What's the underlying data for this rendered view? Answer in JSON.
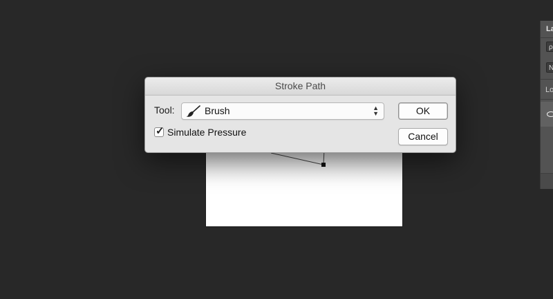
{
  "dialog": {
    "title": "Stroke Path",
    "tool_label": "Tool:",
    "tool_value": "Brush",
    "tool_icon": "brush-icon",
    "simulate_pressure_label": "Simulate Pressure",
    "simulate_pressure_checked": true,
    "ok_label": "OK",
    "cancel_label": "Cancel"
  },
  "layers_panel": {
    "title": "La",
    "kind_filter": "ρ",
    "blend_mode": "N",
    "lock_label": "Lo"
  },
  "colors": {
    "background": "#282828",
    "dialog": "#e5e5e5",
    "panel": "#535353"
  }
}
